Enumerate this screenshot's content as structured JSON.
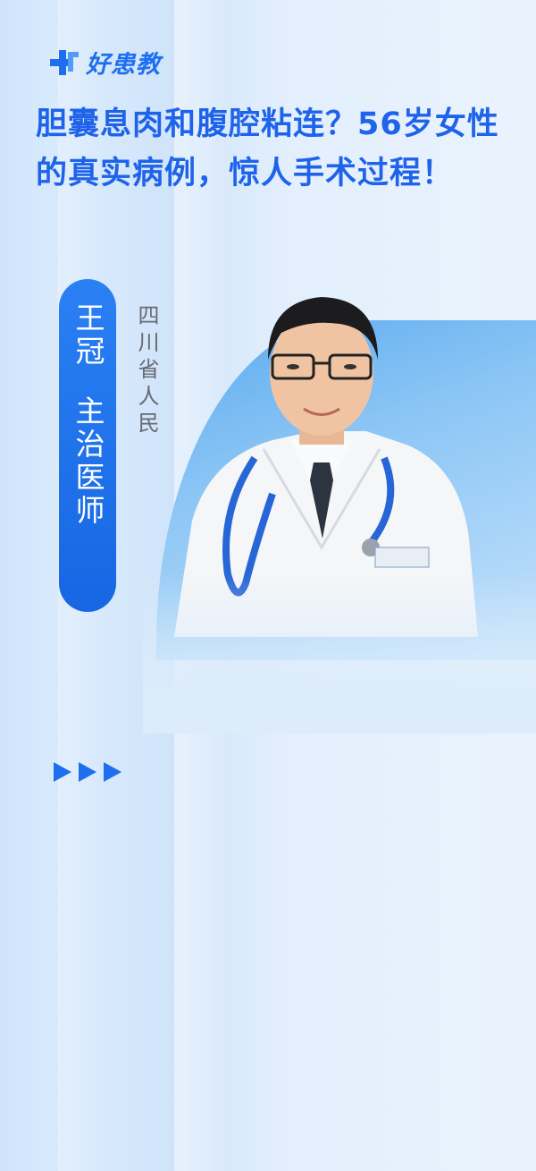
{
  "brand": {
    "name": "好患教",
    "accent": "#1e6ff0"
  },
  "title": "胆囊息肉和腹腔粘连？56岁女性的真实病例，惊人手术过程！",
  "doctor": {
    "name": "王冠",
    "position": "主治医师",
    "hospital": "四川省人民"
  },
  "icons": {
    "logo": "cross-logo-icon",
    "arrows": "triangle-right-icon"
  }
}
